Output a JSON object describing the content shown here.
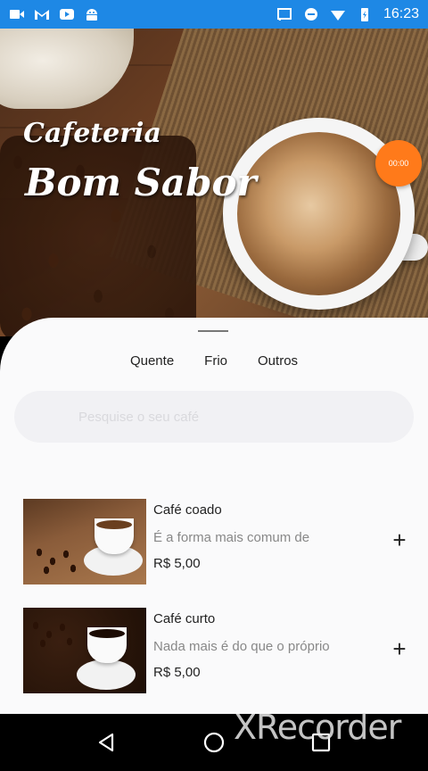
{
  "status_bar": {
    "time": "16:23",
    "left_icons": [
      "video-icon",
      "gmail-icon",
      "youtube-icon",
      "android-icon"
    ],
    "right_icons": [
      "cast-icon",
      "do-not-disturb-icon",
      "wifi-icon",
      "battery-icon"
    ]
  },
  "hero": {
    "title_line1": "Cafeteria",
    "title_line2": "Bom Sabor",
    "timer": "00:00"
  },
  "tabs": [
    {
      "label": "Quente"
    },
    {
      "label": "Frio"
    },
    {
      "label": "Outros"
    }
  ],
  "search": {
    "placeholder": "Pesquise o seu café"
  },
  "items": [
    {
      "name": "Café coado",
      "description": "É a forma mais comum de",
      "price": "R$ 5,00",
      "add_label": "+"
    },
    {
      "name": "Café curto",
      "description": "Nada mais é do que o próprio",
      "price": "R$ 5,00",
      "add_label": "+"
    }
  ],
  "watermark": "XRecorder",
  "colors": {
    "status_bar": "#1e88e5",
    "timer_badge": "#ff7a1a",
    "sheet_bg": "#fafafb"
  }
}
